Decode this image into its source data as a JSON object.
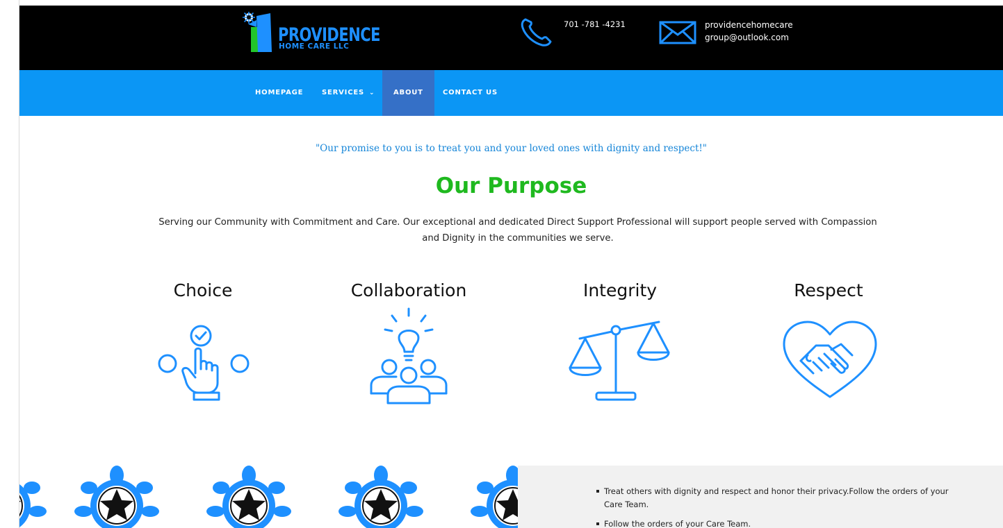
{
  "header": {
    "logo": {
      "title": "PROVIDENCE",
      "subtitle": "HOME CARE LLC"
    },
    "phone": "701 -781 -4231",
    "email_line1": "providencehomecare",
    "email_line2": "group@outlook.com"
  },
  "nav": {
    "items": [
      {
        "label": "HOMEPAGE"
      },
      {
        "label": "SERVICES",
        "has_dropdown": true
      },
      {
        "label": "ABOUT",
        "active": true
      },
      {
        "label": "CONTACT US"
      }
    ],
    "dropdown_icon": "chevron-down-icon"
  },
  "main": {
    "promise": "\"Our promise to you is to treat you and your loved ones with dignity and respect!\"",
    "purpose_title": "Our Purpose",
    "purpose_body": "Serving our Community with Commitment and Care. Our exceptional and dedicated Direct Support Professional will support people served with Compassion and Dignity in the communities we serve.",
    "values": [
      {
        "title": "Choice",
        "icon": "hand-pointer-choice-icon"
      },
      {
        "title": "Collaboration",
        "icon": "team-lightbulb-icon"
      },
      {
        "title": "Integrity",
        "icon": "scales-icon"
      },
      {
        "title": "Respect",
        "icon": "heart-handshake-icon"
      }
    ]
  },
  "bottom": {
    "bullets": [
      "Treat others with dignity and respect and honor their privacy.Follow the orders of your Care Team.",
      "Follow the orders of your Care Team."
    ]
  },
  "colors": {
    "header_bg": "#000000",
    "nav_bg": "#0b96f5",
    "nav_active": "#3570c7",
    "accent_blue": "#1e90ff",
    "purpose_green": "#1fb91f"
  }
}
